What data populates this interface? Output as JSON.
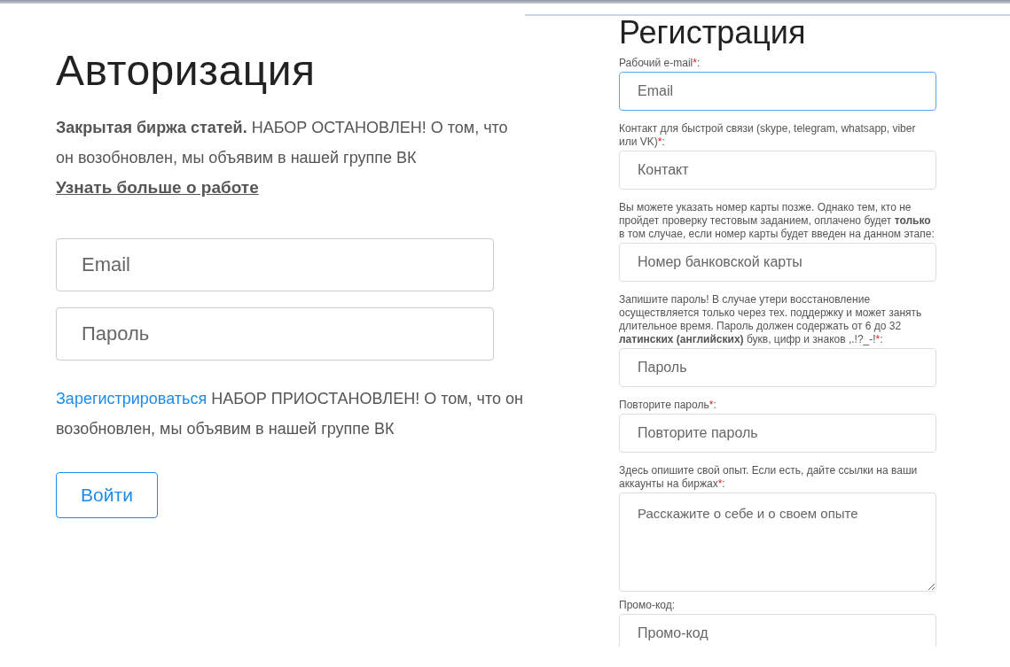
{
  "login": {
    "title": "Авторизация",
    "intro": "**Закрытая биржа статей.** НАБОР ОСТАНОВЛЕН! О том, что он возобновлен, мы объявим в нашей группе ВК",
    "more_link": "Узнать больше о работе",
    "fields": [
      {
        "placeholder": "Email"
      },
      {
        "placeholder": "Пароль"
      }
    ],
    "register_link": "Зарегистрироваться",
    "register_note": "НАБОР ПРИОСТАНОВЛЕН! О том, что он возобновлен, мы объявим в нашей группе ВК",
    "submit": "Войти"
  },
  "registration": {
    "title": "Регистрация",
    "fields": [
      {
        "kind": "input",
        "label": "Рабочий e-mail",
        "required_mark": "*",
        "label_end": ":",
        "placeholder": "Email",
        "focused": true
      },
      {
        "kind": "input",
        "label": "Контакт для быстрой связи (skype, telegram, whatsapp, viber или VK)",
        "required_mark": "*",
        "label_end": ":",
        "placeholder": "Контакт",
        "focused": false
      },
      {
        "kind": "input",
        "label": "Вы можете указать номер карты позже. Однако тем, кто не пройдет проверку тестовым заданием, оплачено будет **только** в том случае, если номер карты будет введен на данном этапе",
        "label_end": ":",
        "placeholder": "Номер банковской карты",
        "focused": false
      },
      {
        "kind": "input",
        "label": "Запишите пароль! В случае утери восстановление осуществляется только через тех. поддержку и может занять длительное время. Пароль должен содержать от 6 до 32 **латинских (английских)** букв, цифр и знаков ,.!?_-!",
        "required_mark": "*",
        "label_end": ":",
        "placeholder": "Пароль",
        "focused": false
      },
      {
        "kind": "input",
        "label": "Повторите пароль",
        "required_mark": "*",
        "label_end": ":",
        "placeholder": "Повторите пароль",
        "focused": false
      },
      {
        "kind": "textarea",
        "label": "Здесь опишите свой опыт. Если есть, дайте ссылки на ваши аккаунты на биржах",
        "required_mark": "*",
        "label_end": ":",
        "placeholder": "Расскажите о себе и о своем опыте",
        "focused": false
      },
      {
        "kind": "input",
        "label": "Промо-код",
        "label_end": ":",
        "placeholder": "Промо-код",
        "focused": false
      }
    ]
  }
}
